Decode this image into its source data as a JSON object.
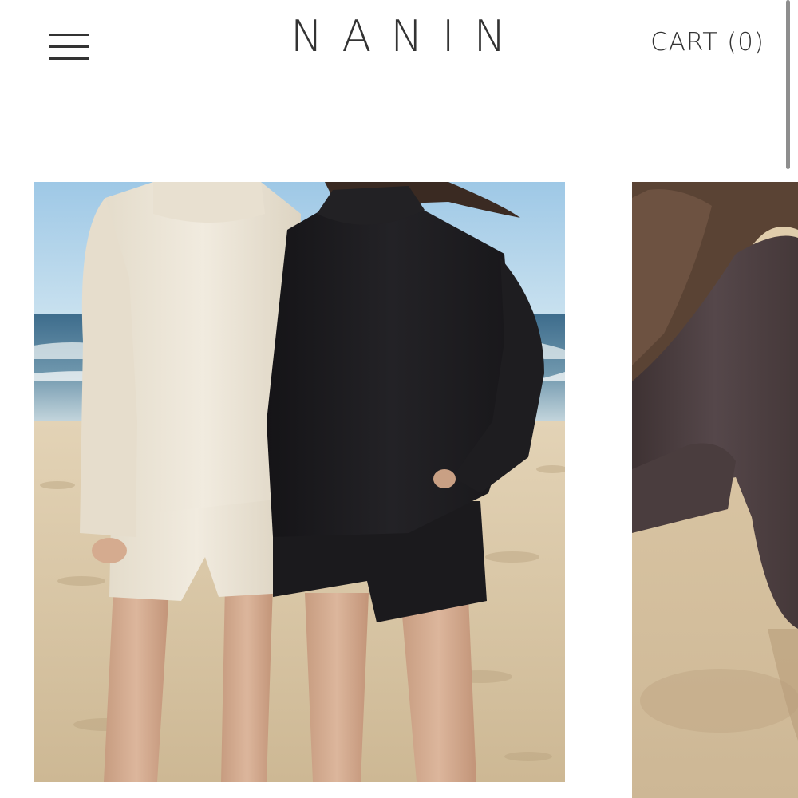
{
  "header": {
    "brand": "NANIN",
    "cart_label": "CART (0)",
    "menu_icon": "hamburger-menu-icon"
  },
  "products": [
    {
      "image": "beach-two-models-cream-and-black-waffle-knit-sets",
      "alt": ""
    },
    {
      "image": "model-in-brown-waffle-knit-sweater-on-sand",
      "alt": ""
    }
  ],
  "colors": {
    "text": "#333333",
    "background": "#ffffff",
    "cream_knit": "#eee6d6",
    "black_knit": "#1c1b1d",
    "brown_knit": "#4b3c3c",
    "sand": "#d9c5a6",
    "sky": "#a9cfe6",
    "sea": "#3f6f8f"
  }
}
